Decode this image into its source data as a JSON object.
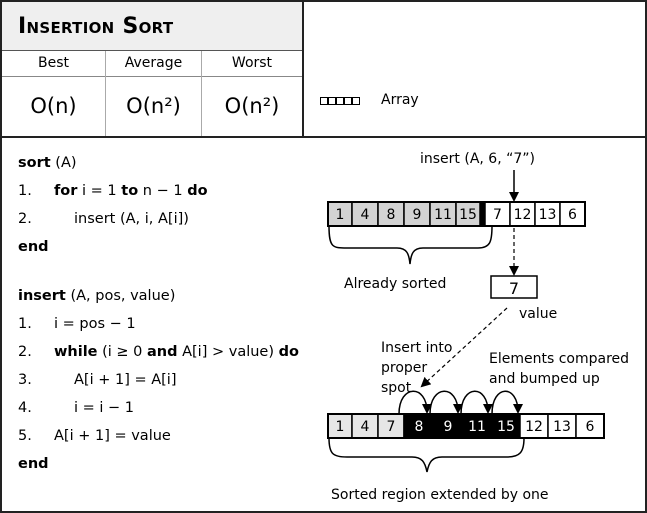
{
  "header": {
    "title": "Insertion Sort"
  },
  "complexity": {
    "columns": [
      {
        "label": "Best",
        "value": "O(n)"
      },
      {
        "label": "Average",
        "value": "O(n²)"
      },
      {
        "label": "Worst",
        "value": "O(n²)"
      }
    ]
  },
  "legend": {
    "icon": "array-icon",
    "label": "Array"
  },
  "sort_proc": {
    "signature_kw": "sort",
    "signature_args": " (A)",
    "lines": [
      {
        "num": "1.",
        "parts": [
          [
            "kw",
            "for"
          ],
          [
            "t",
            " i = 1 "
          ],
          [
            "kw",
            "to"
          ],
          [
            "t",
            " n − 1 "
          ],
          [
            "kw",
            "do"
          ]
        ],
        "indent": 0
      },
      {
        "num": "2.",
        "parts": [
          [
            "t",
            "insert (A, i, A[i])"
          ]
        ],
        "indent": 1
      }
    ],
    "end": "end"
  },
  "insert_proc": {
    "signature_kw": "insert",
    "signature_args": " (A, pos, value)",
    "lines": [
      {
        "num": "1.",
        "parts": [
          [
            "t",
            "i = pos − 1"
          ]
        ],
        "indent": 0
      },
      {
        "num": "2.",
        "parts": [
          [
            "kw",
            "while"
          ],
          [
            "t",
            " (i ≥ 0 "
          ],
          [
            "kw",
            "and"
          ],
          [
            "t",
            " A[i] > value) "
          ],
          [
            "kw",
            "do"
          ]
        ],
        "indent": 0
      },
      {
        "num": "3.",
        "parts": [
          [
            "t",
            "A[i + 1] = A[i]"
          ]
        ],
        "indent": 1
      },
      {
        "num": "4.",
        "parts": [
          [
            "t",
            "i = i − 1"
          ]
        ],
        "indent": 1
      },
      {
        "num": "5.",
        "parts": [
          [
            "t",
            "A[i + 1] = value"
          ]
        ],
        "indent": 0
      }
    ],
    "end": "end"
  },
  "diagram": {
    "call_label": "insert (A, 6, “7”)",
    "before_array": [
      "1",
      "4",
      "8",
      "9",
      "11",
      "15",
      "7",
      "12",
      "13",
      "6"
    ],
    "before_sorted_count": 6,
    "already_sorted_label": "Already sorted",
    "value_box": "7",
    "value_label": "value",
    "insert_label": [
      "Insert into",
      "proper",
      "spot"
    ],
    "bumped_label": [
      "Elements compared",
      "and bumped up"
    ],
    "after_array": [
      "1",
      "4",
      "7",
      "8",
      "9",
      "11",
      "15",
      "12",
      "13",
      "6"
    ],
    "after_light_count": 3,
    "after_dark_count": 4,
    "extended_label": "Sorted region extended by one",
    "colors": {
      "sorted": "#d3d3d3",
      "light": "#e6e6e6",
      "dark": "#000000",
      "unsorted": "#ffffff"
    }
  }
}
